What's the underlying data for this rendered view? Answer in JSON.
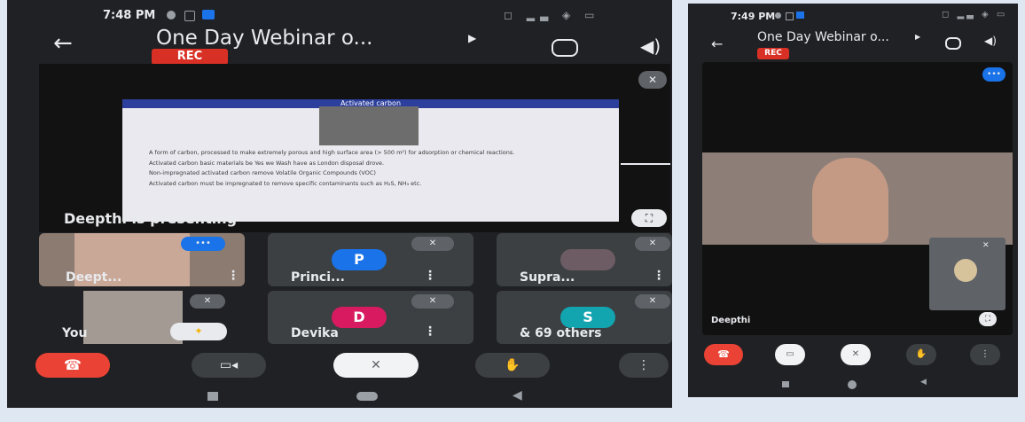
{
  "left": {
    "status": {
      "time": "7:48 PM"
    },
    "header": {
      "title": "One Day Webinar o...",
      "rec": "REC"
    },
    "presentation": {
      "slide_title": "Activated carbon",
      "bullets": [
        "A form of carbon, processed to make extremely porous and high surface area (> 500 m²) for adsorption or chemical reactions.",
        "Activated carbon basic materials be Yes we Wash have as London disposal drove.",
        "Non-impregnated activated carbon remove Volatile Organic Compounds (VOC)",
        "Activated carbon must be impregnated to remove specific contaminants such as H₂S, NH₃ etc."
      ],
      "presenting_label": "Deepthi is presenting"
    },
    "tiles": [
      {
        "name": "Deept...",
        "initial": ""
      },
      {
        "name": "Princi...",
        "initial": "P"
      },
      {
        "name": "Supra...",
        "initial": ""
      },
      {
        "name": "You",
        "initial": ""
      },
      {
        "name": "Devika",
        "initial": "D"
      },
      {
        "name": "& 69 others",
        "initial": "S"
      }
    ],
    "colors": {
      "princi": "#1a73e8",
      "devika": "#d81b60",
      "others": "#12a4af",
      "end_call": "#ea4335"
    }
  },
  "right": {
    "status": {
      "time": "7:49 PM"
    },
    "header": {
      "title": "One Day Webinar o...",
      "rec": "REC"
    },
    "speaker_name": "Deepthi"
  }
}
